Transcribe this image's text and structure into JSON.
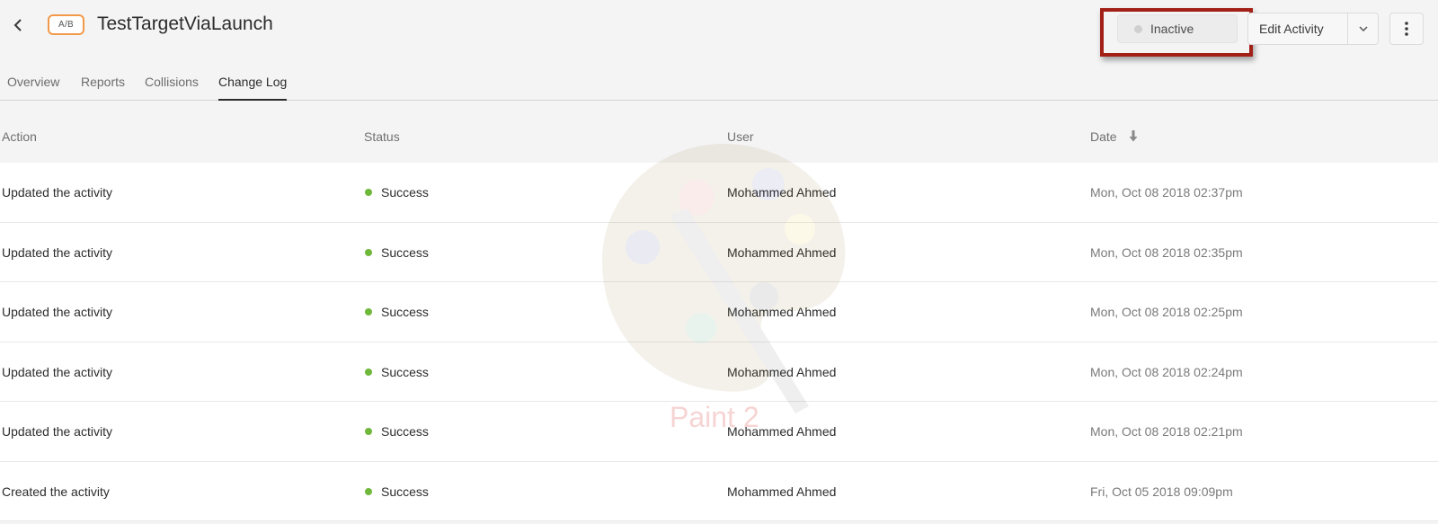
{
  "header": {
    "back_icon": "chevron-left-icon",
    "badge": "A/B",
    "title": "TestTargetViaLaunch",
    "status_label": "Inactive",
    "edit_label": "Edit Activity",
    "dropdown_icon": "chevron-down-icon",
    "more_icon": "more-vertical-icon",
    "highlight_color": "#a32019",
    "badge_color": "#f29a4a"
  },
  "tabs": [
    {
      "label": "Overview",
      "active": false
    },
    {
      "label": "Reports",
      "active": false
    },
    {
      "label": "Collisions",
      "active": false
    },
    {
      "label": "Change Log",
      "active": true
    }
  ],
  "table": {
    "columns": [
      "Action",
      "Status",
      "User",
      "Date"
    ],
    "sort_icon": "arrow-down-icon",
    "success_color": "#6fb83b",
    "rows": [
      {
        "action": "Updated the activity",
        "status": "Success",
        "user": "Mohammed Ahmed",
        "date": "Mon, Oct 08 2018 02:37pm"
      },
      {
        "action": "Updated the activity",
        "status": "Success",
        "user": "Mohammed Ahmed",
        "date": "Mon, Oct 08 2018 02:35pm"
      },
      {
        "action": "Updated the activity",
        "status": "Success",
        "user": "Mohammed Ahmed",
        "date": "Mon, Oct 08 2018 02:25pm"
      },
      {
        "action": "Updated the activity",
        "status": "Success",
        "user": "Mohammed Ahmed",
        "date": "Mon, Oct 08 2018 02:24pm"
      },
      {
        "action": "Updated the activity",
        "status": "Success",
        "user": "Mohammed Ahmed",
        "date": "Mon, Oct 08 2018 02:21pm"
      },
      {
        "action": "Created the activity",
        "status": "Success",
        "user": "Mohammed Ahmed",
        "date": "Fri, Oct 05 2018 09:09pm"
      }
    ]
  },
  "watermark": {
    "text": "Paint 2",
    "icon": "paint-palette-icon"
  }
}
